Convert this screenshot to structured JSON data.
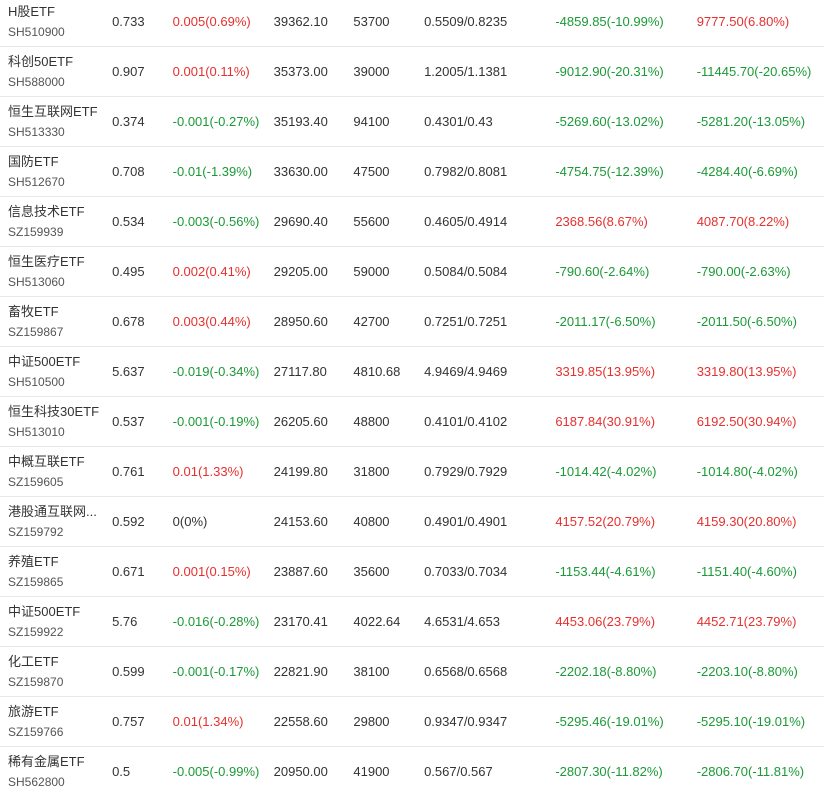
{
  "rows": [
    {
      "name": "H股ETF",
      "code": "SH510900",
      "price": "0.733",
      "change": "0.005(0.69%)",
      "change_dir": "up",
      "amount": "39362.10",
      "volume": "53700",
      "bid_ask": "0.5509/0.8235",
      "flow1": "-4859.85(-10.99%)",
      "flow1_dir": "down",
      "flow2": "9777.50(6.80%)",
      "flow2_dir": "up"
    },
    {
      "name": "科创50ETF",
      "code": "SH588000",
      "price": "0.907",
      "change": "0.001(0.11%)",
      "change_dir": "up",
      "amount": "35373.00",
      "volume": "39000",
      "bid_ask": "1.2005/1.1381",
      "flow1": "-9012.90(-20.31%)",
      "flow1_dir": "down",
      "flow2": "-11445.70(-20.65%)",
      "flow2_dir": "down"
    },
    {
      "name": "恒生互联网ETF",
      "code": "SH513330",
      "price": "0.374",
      "change": "-0.001(-0.27%)",
      "change_dir": "down",
      "amount": "35193.40",
      "volume": "94100",
      "bid_ask": "0.4301/0.43",
      "flow1": "-5269.60(-13.02%)",
      "flow1_dir": "down",
      "flow2": "-5281.20(-13.05%)",
      "flow2_dir": "down"
    },
    {
      "name": "国防ETF",
      "code": "SH512670",
      "price": "0.708",
      "change": "-0.01(-1.39%)",
      "change_dir": "down",
      "amount": "33630.00",
      "volume": "47500",
      "bid_ask": "0.7982/0.8081",
      "flow1": "-4754.75(-12.39%)",
      "flow1_dir": "down",
      "flow2": "-4284.40(-6.69%)",
      "flow2_dir": "down"
    },
    {
      "name": "信息技术ETF",
      "code": "SZ159939",
      "price": "0.534",
      "change": "-0.003(-0.56%)",
      "change_dir": "down",
      "amount": "29690.40",
      "volume": "55600",
      "bid_ask": "0.4605/0.4914",
      "flow1": "2368.56(8.67%)",
      "flow1_dir": "up",
      "flow2": "4087.70(8.22%)",
      "flow2_dir": "up"
    },
    {
      "name": "恒生医疗ETF",
      "code": "SH513060",
      "price": "0.495",
      "change": "0.002(0.41%)",
      "change_dir": "up",
      "amount": "29205.00",
      "volume": "59000",
      "bid_ask": "0.5084/0.5084",
      "flow1": "-790.60(-2.64%)",
      "flow1_dir": "down",
      "flow2": "-790.00(-2.63%)",
      "flow2_dir": "down"
    },
    {
      "name": "畜牧ETF",
      "code": "SZ159867",
      "price": "0.678",
      "change": "0.003(0.44%)",
      "change_dir": "up",
      "amount": "28950.60",
      "volume": "42700",
      "bid_ask": "0.7251/0.7251",
      "flow1": "-2011.17(-6.50%)",
      "flow1_dir": "down",
      "flow2": "-2011.50(-6.50%)",
      "flow2_dir": "down"
    },
    {
      "name": "中证500ETF",
      "code": "SH510500",
      "price": "5.637",
      "change": "-0.019(-0.34%)",
      "change_dir": "down",
      "amount": "27117.80",
      "volume": "4810.68",
      "bid_ask": "4.9469/4.9469",
      "flow1": "3319.85(13.95%)",
      "flow1_dir": "up",
      "flow2": "3319.80(13.95%)",
      "flow2_dir": "up"
    },
    {
      "name": "恒生科技30ETF",
      "code": "SH513010",
      "price": "0.537",
      "change": "-0.001(-0.19%)",
      "change_dir": "down",
      "amount": "26205.60",
      "volume": "48800",
      "bid_ask": "0.4101/0.4102",
      "flow1": "6187.84(30.91%)",
      "flow1_dir": "up",
      "flow2": "6192.50(30.94%)",
      "flow2_dir": "up"
    },
    {
      "name": "中概互联ETF",
      "code": "SZ159605",
      "price": "0.761",
      "change": "0.01(1.33%)",
      "change_dir": "up",
      "amount": "24199.80",
      "volume": "31800",
      "bid_ask": "0.7929/0.7929",
      "flow1": "-1014.42(-4.02%)",
      "flow1_dir": "down",
      "flow2": "-1014.80(-4.02%)",
      "flow2_dir": "down"
    },
    {
      "name": "港股通互联网...",
      "code": "SZ159792",
      "price": "0.592",
      "change": "0(0%)",
      "change_dir": "flat",
      "amount": "24153.60",
      "volume": "40800",
      "bid_ask": "0.4901/0.4901",
      "flow1": "4157.52(20.79%)",
      "flow1_dir": "up",
      "flow2": "4159.30(20.80%)",
      "flow2_dir": "up"
    },
    {
      "name": "养殖ETF",
      "code": "SZ159865",
      "price": "0.671",
      "change": "0.001(0.15%)",
      "change_dir": "up",
      "amount": "23887.60",
      "volume": "35600",
      "bid_ask": "0.7033/0.7034",
      "flow1": "-1153.44(-4.61%)",
      "flow1_dir": "down",
      "flow2": "-1151.40(-4.60%)",
      "flow2_dir": "down"
    },
    {
      "name": "中证500ETF",
      "code": "SZ159922",
      "price": "5.76",
      "change": "-0.016(-0.28%)",
      "change_dir": "down",
      "amount": "23170.41",
      "volume": "4022.64",
      "bid_ask": "4.6531/4.653",
      "flow1": "4453.06(23.79%)",
      "flow1_dir": "up",
      "flow2": "4452.71(23.79%)",
      "flow2_dir": "up"
    },
    {
      "name": "化工ETF",
      "code": "SZ159870",
      "price": "0.599",
      "change": "-0.001(-0.17%)",
      "change_dir": "down",
      "amount": "22821.90",
      "volume": "38100",
      "bid_ask": "0.6568/0.6568",
      "flow1": "-2202.18(-8.80%)",
      "flow1_dir": "down",
      "flow2": "-2203.10(-8.80%)",
      "flow2_dir": "down"
    },
    {
      "name": "旅游ETF",
      "code": "SZ159766",
      "price": "0.757",
      "change": "0.01(1.34%)",
      "change_dir": "up",
      "amount": "22558.60",
      "volume": "29800",
      "bid_ask": "0.9347/0.9347",
      "flow1": "-5295.46(-19.01%)",
      "flow1_dir": "down",
      "flow2": "-5295.10(-19.01%)",
      "flow2_dir": "down"
    },
    {
      "name": "稀有金属ETF",
      "code": "SH562800",
      "price": "0.5",
      "change": "-0.005(-0.99%)",
      "change_dir": "down",
      "amount": "20950.00",
      "volume": "41900",
      "bid_ask": "0.567/0.567",
      "flow1": "-2807.30(-11.82%)",
      "flow1_dir": "down",
      "flow2": "-2806.70(-11.81%)",
      "flow2_dir": "down"
    }
  ],
  "colors": {
    "up": "#e5302e",
    "down": "#1a9a36",
    "flat": "#333333",
    "row_border": "#e8e8e8"
  }
}
